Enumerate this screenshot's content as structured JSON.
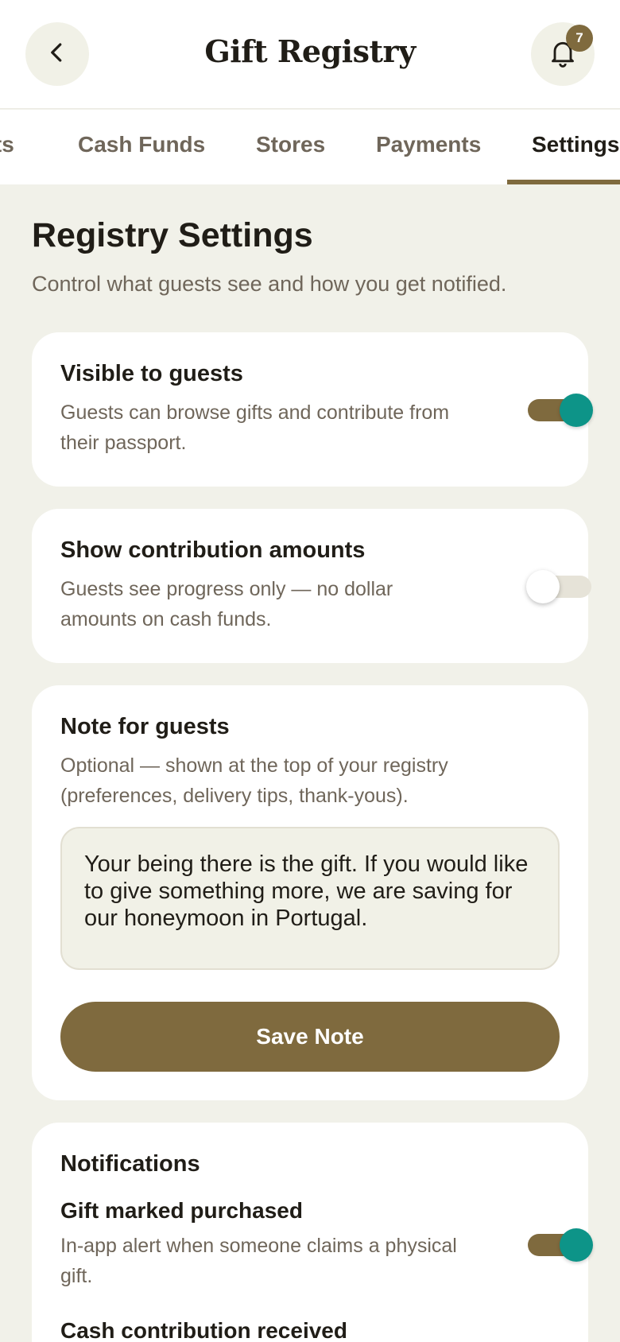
{
  "header": {
    "title": "Gift Registry",
    "notification_count": "7",
    "back_icon": "chevron-left-icon",
    "bell_icon": "bell-icon"
  },
  "tabs": [
    {
      "label": "Gifts"
    },
    {
      "label": "Cash Funds"
    },
    {
      "label": "Stores"
    },
    {
      "label": "Payments"
    },
    {
      "label": "Settings",
      "active": true
    }
  ],
  "page": {
    "title": "Registry Settings",
    "subtitle": "Control what guests see and how you get notified."
  },
  "visibility": {
    "title": "Visible to guests",
    "description": "Guests can browse gifts and contribute from their passport.",
    "enabled": true
  },
  "amounts": {
    "title": "Show contribution amounts",
    "description": "Guests see progress only — no dollar amounts on cash funds.",
    "enabled": false
  },
  "note": {
    "title": "Note for guests",
    "description": "Optional — shown at the top of your registry (preferences, delivery tips, thank-yous).",
    "value": "Your being there is the gift. If you would like to give something more, we are saving for our honeymoon in Portugal.",
    "save_label": "Save Note"
  },
  "notifications": {
    "title": "Notifications",
    "items": [
      {
        "title": "Gift marked purchased",
        "description": "In-app alert when someone claims a physical gift.",
        "enabled": true
      },
      {
        "title": "Cash contribution received"
      }
    ]
  },
  "colors": {
    "accent": "#7f6a3e",
    "toggle_knob_on": "#0d9488",
    "background": "#f1f1e9"
  }
}
